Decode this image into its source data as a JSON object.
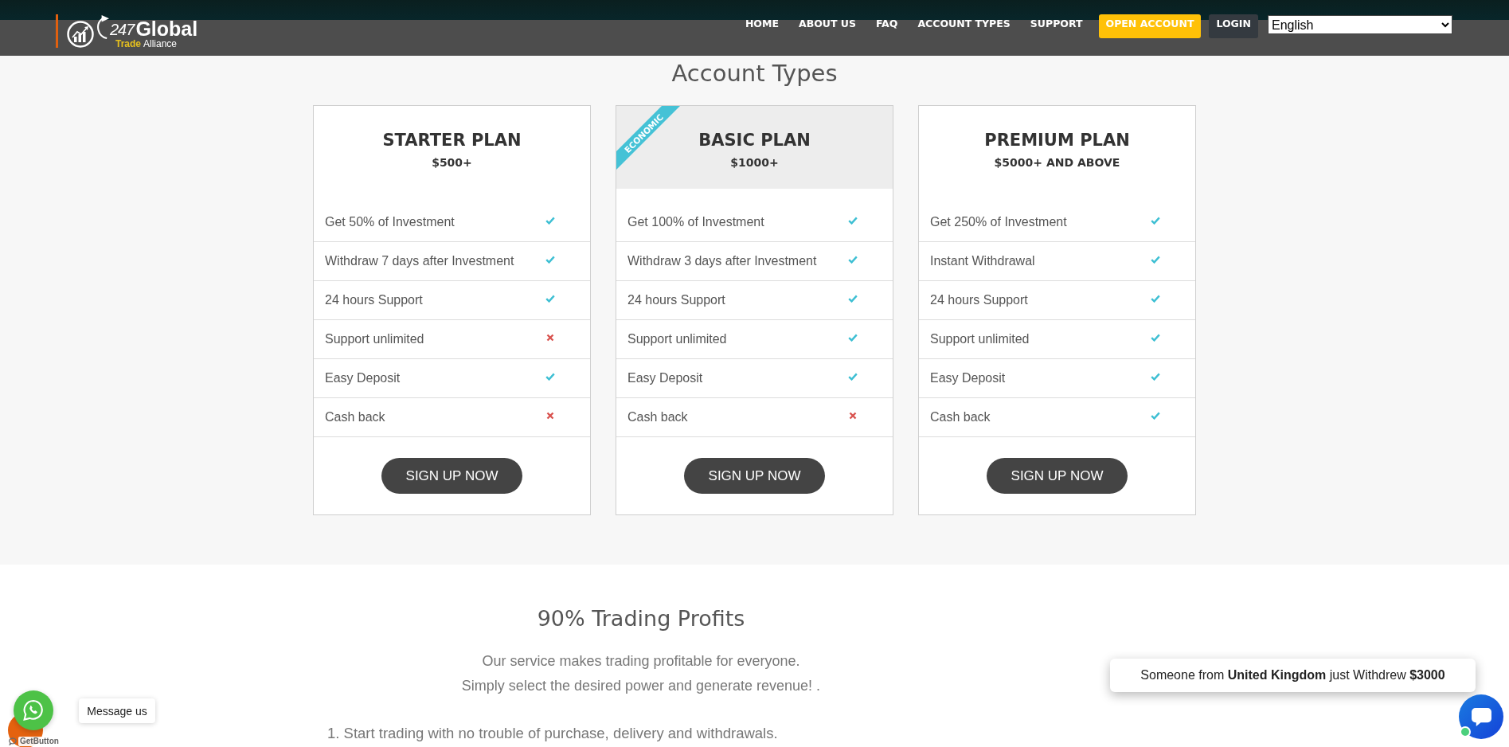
{
  "header": {
    "logo": {
      "number": "247",
      "name": "Global",
      "tagline": [
        {
          "text": "Trade",
          "color": "#e6c01e"
        },
        {
          "text": "Alliance",
          "color": "#ffffff"
        }
      ]
    },
    "nav": [
      {
        "label": "HOME",
        "kind": "link"
      },
      {
        "label": "ABOUT US",
        "kind": "link"
      },
      {
        "label": "FAQ",
        "kind": "link"
      },
      {
        "label": "ACCOUNT TYPES",
        "kind": "link"
      },
      {
        "label": "SUPPORT",
        "kind": "link"
      },
      {
        "label": "OPEN ACCOUNT",
        "kind": "highlight"
      },
      {
        "label": "LOGIN",
        "kind": "dark"
      }
    ],
    "language_select": {
      "value": "English"
    }
  },
  "account_types": {
    "title": "Account Types",
    "plans": [
      {
        "name": "STARTER PLAN",
        "price": "$500+",
        "featured": false,
        "features": [
          {
            "text": "Get 50% of Investment",
            "included": true
          },
          {
            "text": "Withdraw 7 days after Investment",
            "included": true
          },
          {
            "text": "24 hours Support",
            "included": true
          },
          {
            "text": "Support unlimited",
            "included": false
          },
          {
            "text": "Easy Deposit",
            "included": true
          },
          {
            "text": "Cash back",
            "included": false
          }
        ],
        "button": "SIGN UP NOW"
      },
      {
        "name": "BASIC PLAN",
        "price": "$1000+",
        "featured": true,
        "ribbon": "ECONOMIC",
        "features": [
          {
            "text": "Get 100% of Investment",
            "included": true
          },
          {
            "text": "Withdraw 3 days after Investment",
            "included": true
          },
          {
            "text": "24 hours Support",
            "included": true
          },
          {
            "text": "Support unlimited",
            "included": true
          },
          {
            "text": "Easy Deposit",
            "included": true
          },
          {
            "text": "Cash back",
            "included": false
          }
        ],
        "button": "SIGN UP NOW"
      },
      {
        "name": "PREMIUM PLAN",
        "price": "$5000+ AND ABOVE",
        "featured": false,
        "features": [
          {
            "text": "Get 250% of Investment",
            "included": true
          },
          {
            "text": "Instant Withdrawal",
            "included": true
          },
          {
            "text": "24 hours Support",
            "included": true
          },
          {
            "text": "Support unlimited",
            "included": true
          },
          {
            "text": "Easy Deposit",
            "included": true
          },
          {
            "text": "Cash back",
            "included": true
          }
        ],
        "button": "SIGN UP NOW"
      }
    ]
  },
  "trading_profits": {
    "title": "90% Trading Profits",
    "lines": [
      "Our service makes trading profitable for everyone.",
      "Simply select the desired power and generate revenue! ."
    ],
    "list": [
      "1. Start trading with no trouble of purchase, delivery and withdrawals."
    ]
  },
  "widgets": {
    "message_tooltip": "Message us",
    "powered_by": "GetButton",
    "toast": "Someone from **United Kingdom** just Withdrew **$3000**",
    "chat_online": true
  }
}
